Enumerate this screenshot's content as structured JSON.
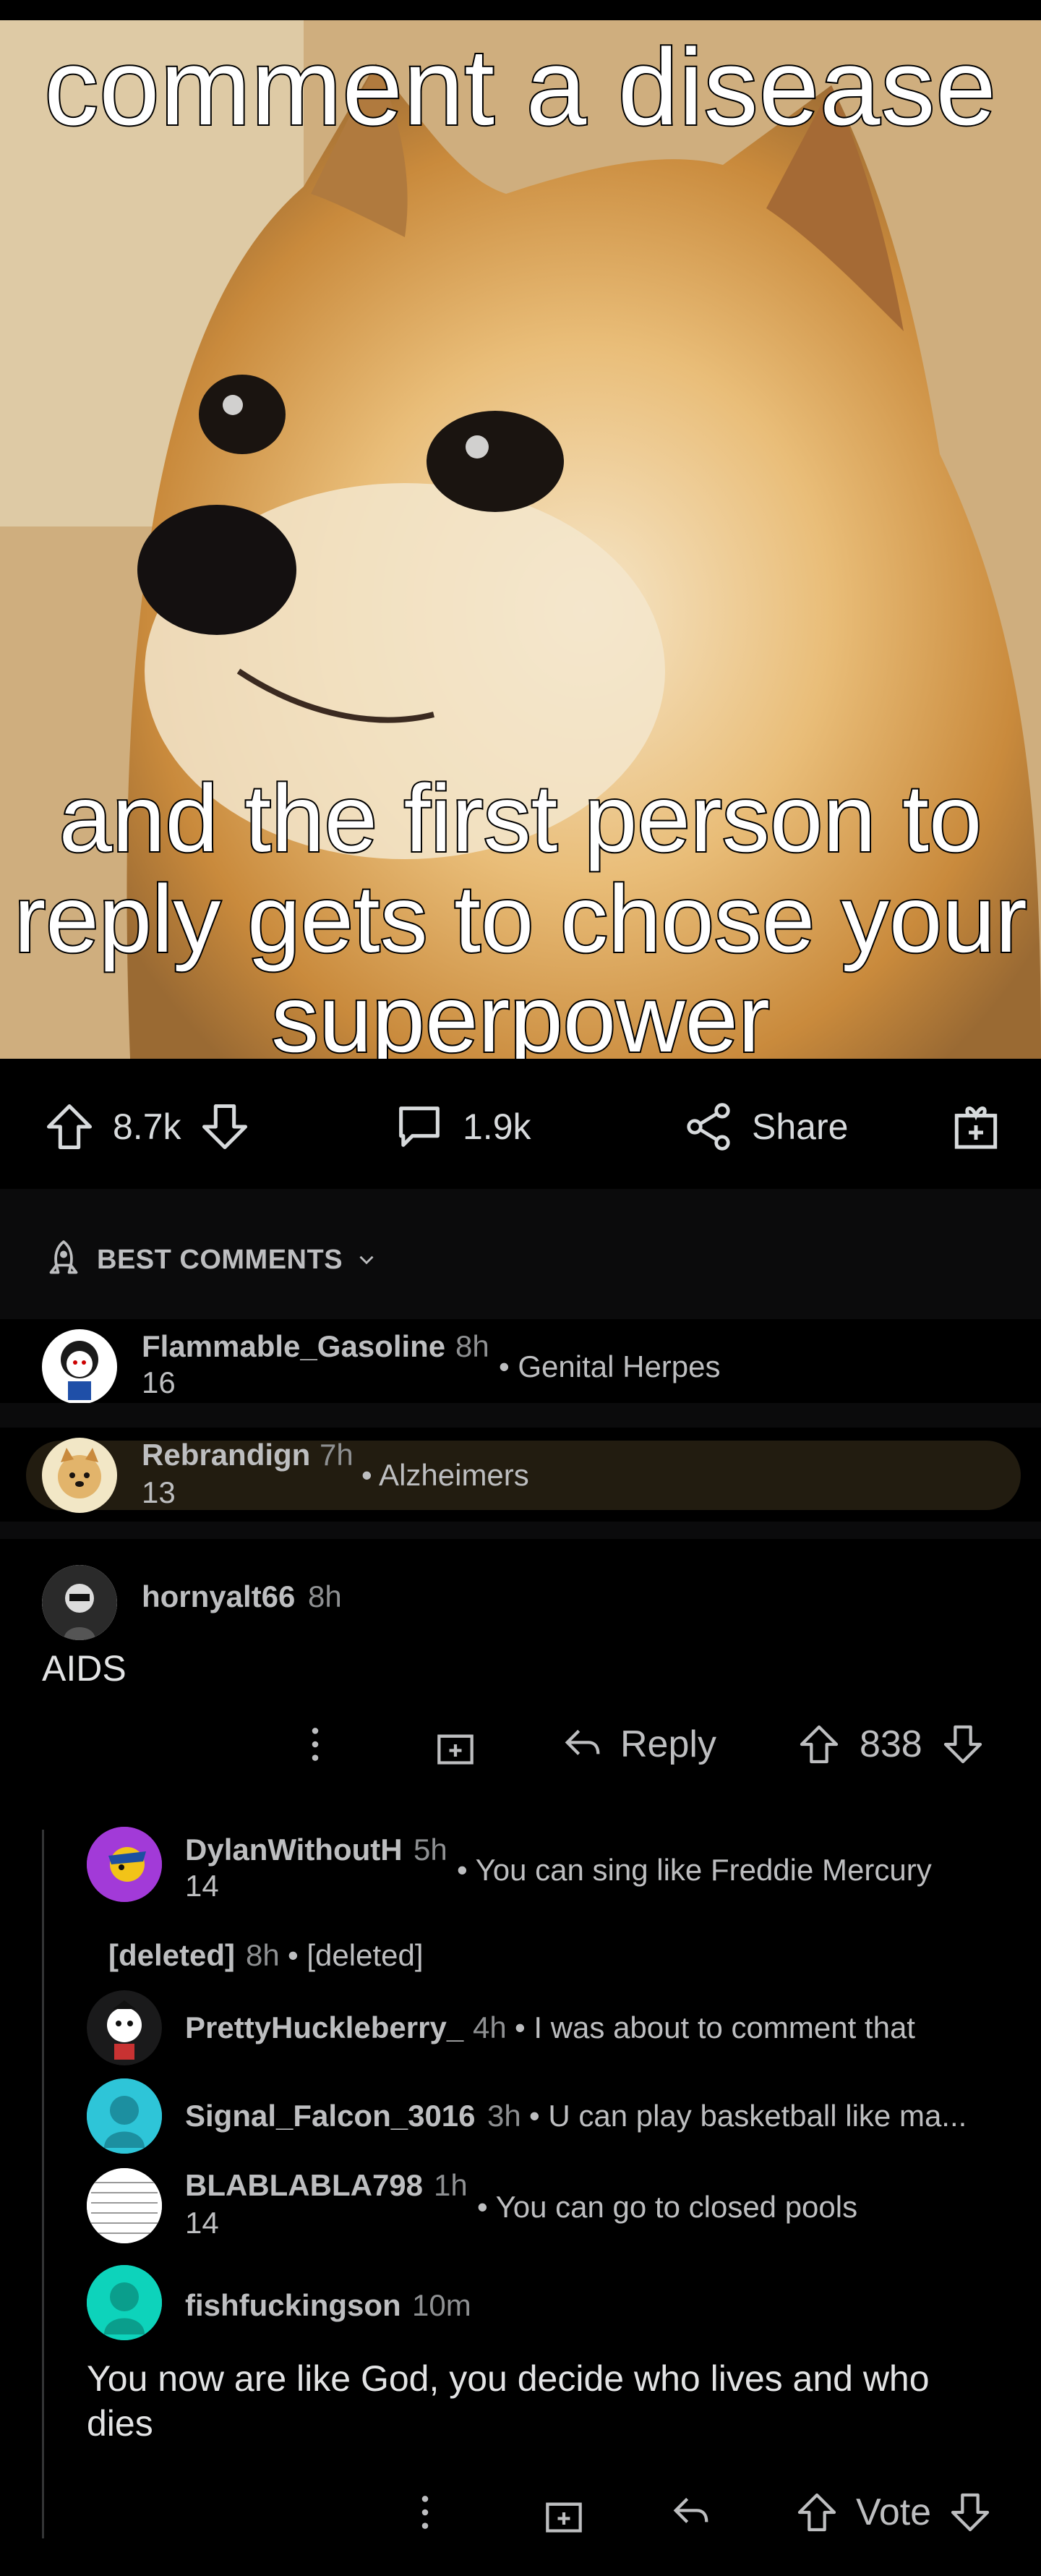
{
  "meme": {
    "top_caption": "comment a disease",
    "bottom_caption": "and the first person to reply gets to chose your superpower"
  },
  "post_bar": {
    "upvotes": "8.7k",
    "comments": "1.9k",
    "share": "Share"
  },
  "sort": {
    "label": "BEST COMMENTS"
  },
  "collapsed": [
    {
      "user": "Flammable_Gasoline",
      "age": "8h",
      "score": "16",
      "snippet": "• Genital Herpes"
    },
    {
      "user": "Rebrandign",
      "age": "7h",
      "score": "13",
      "snippet": "• Alzheimers"
    }
  ],
  "main_comment": {
    "user": "hornyalt66",
    "age": "8h",
    "text": "AIDS",
    "reply": "Reply",
    "score": "838"
  },
  "replies": [
    {
      "user": "DylanWithoutH",
      "age": "5h",
      "score": "14",
      "snippet": "• You can sing like Freddie Mercury"
    },
    {
      "user": "[deleted]",
      "age": "8h",
      "snippet": "• [deleted]"
    },
    {
      "user": "PrettyHuckleberry_",
      "age": "4h",
      "snippet": "• I was about to comment that"
    },
    {
      "user": "Signal_Falcon_3016",
      "age": "3h",
      "snippet": "• U can play basketball like ma..."
    },
    {
      "user": "BLABLABLA798",
      "age": "1h",
      "score": "14",
      "snippet": "• You can go to closed pools"
    }
  ],
  "last_reply": {
    "user": "fishfuckingson",
    "age": "10m",
    "text": "You now are like God, you decide who lives and who dies",
    "vote": "Vote"
  },
  "colors": {
    "bg": "#000000",
    "highlight": "#221c10",
    "text": "#d7dadc",
    "muted": "#8e9092"
  }
}
